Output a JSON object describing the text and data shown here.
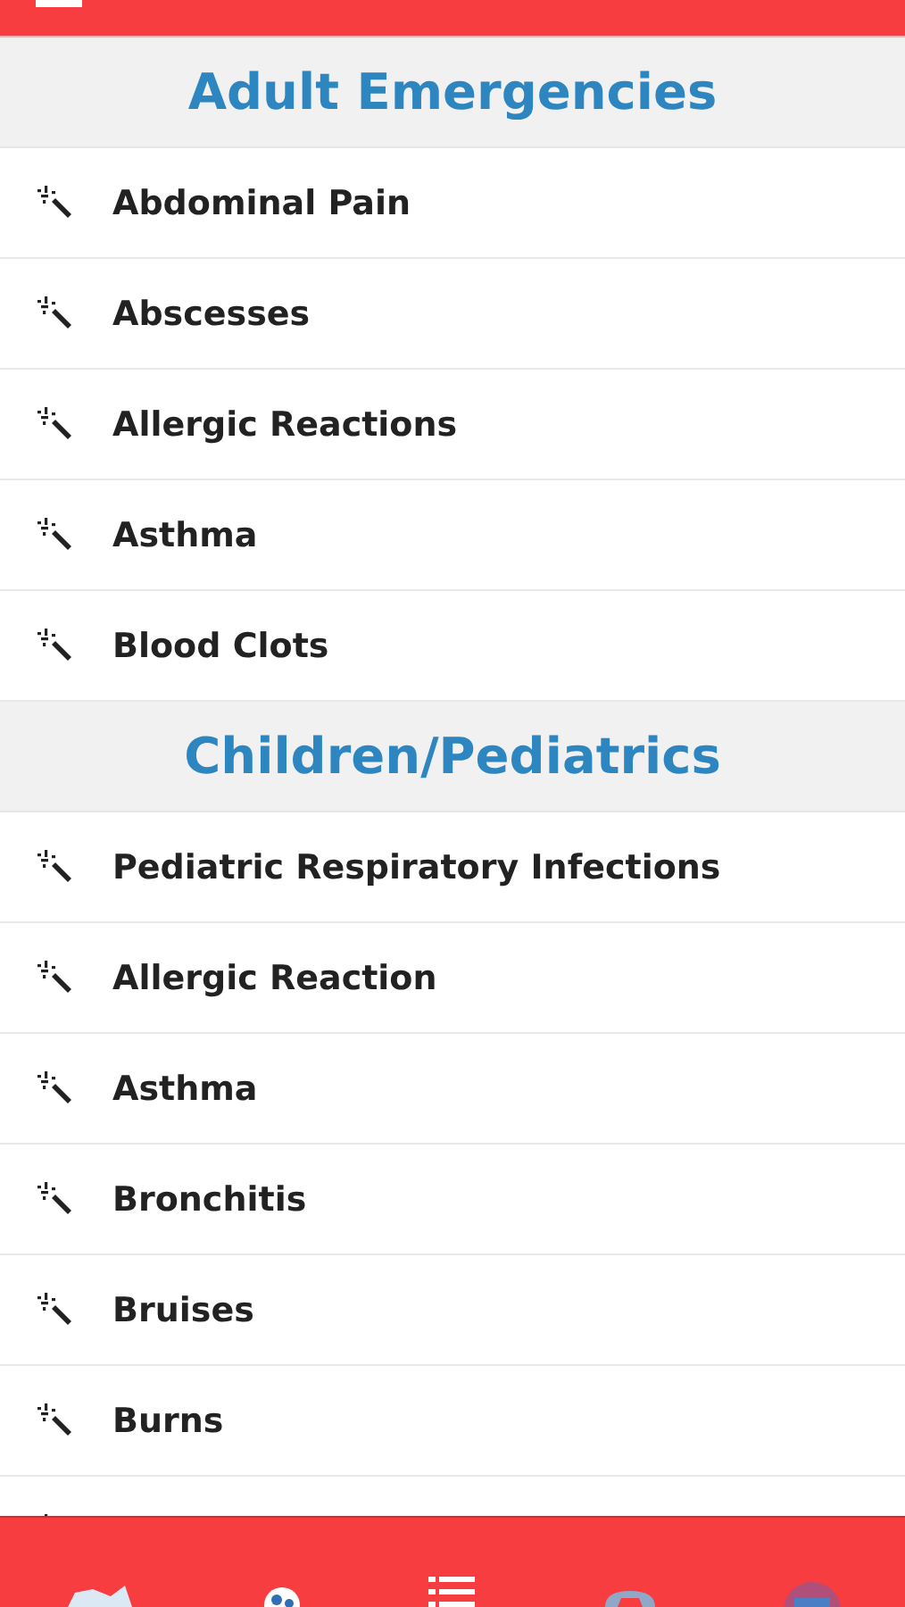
{
  "sections": [
    {
      "title": "Adult Emergencies",
      "items": [
        "Abdominal Pain",
        "Abscesses",
        "Allergic Reactions",
        "Asthma",
        "Blood Clots"
      ]
    },
    {
      "title": "Children/Pediatrics",
      "items": [
        "Pediatric Respiratory Infections",
        "Allergic Reaction",
        "Asthma",
        "Bronchitis",
        "Bruises",
        "Burns"
      ]
    }
  ]
}
